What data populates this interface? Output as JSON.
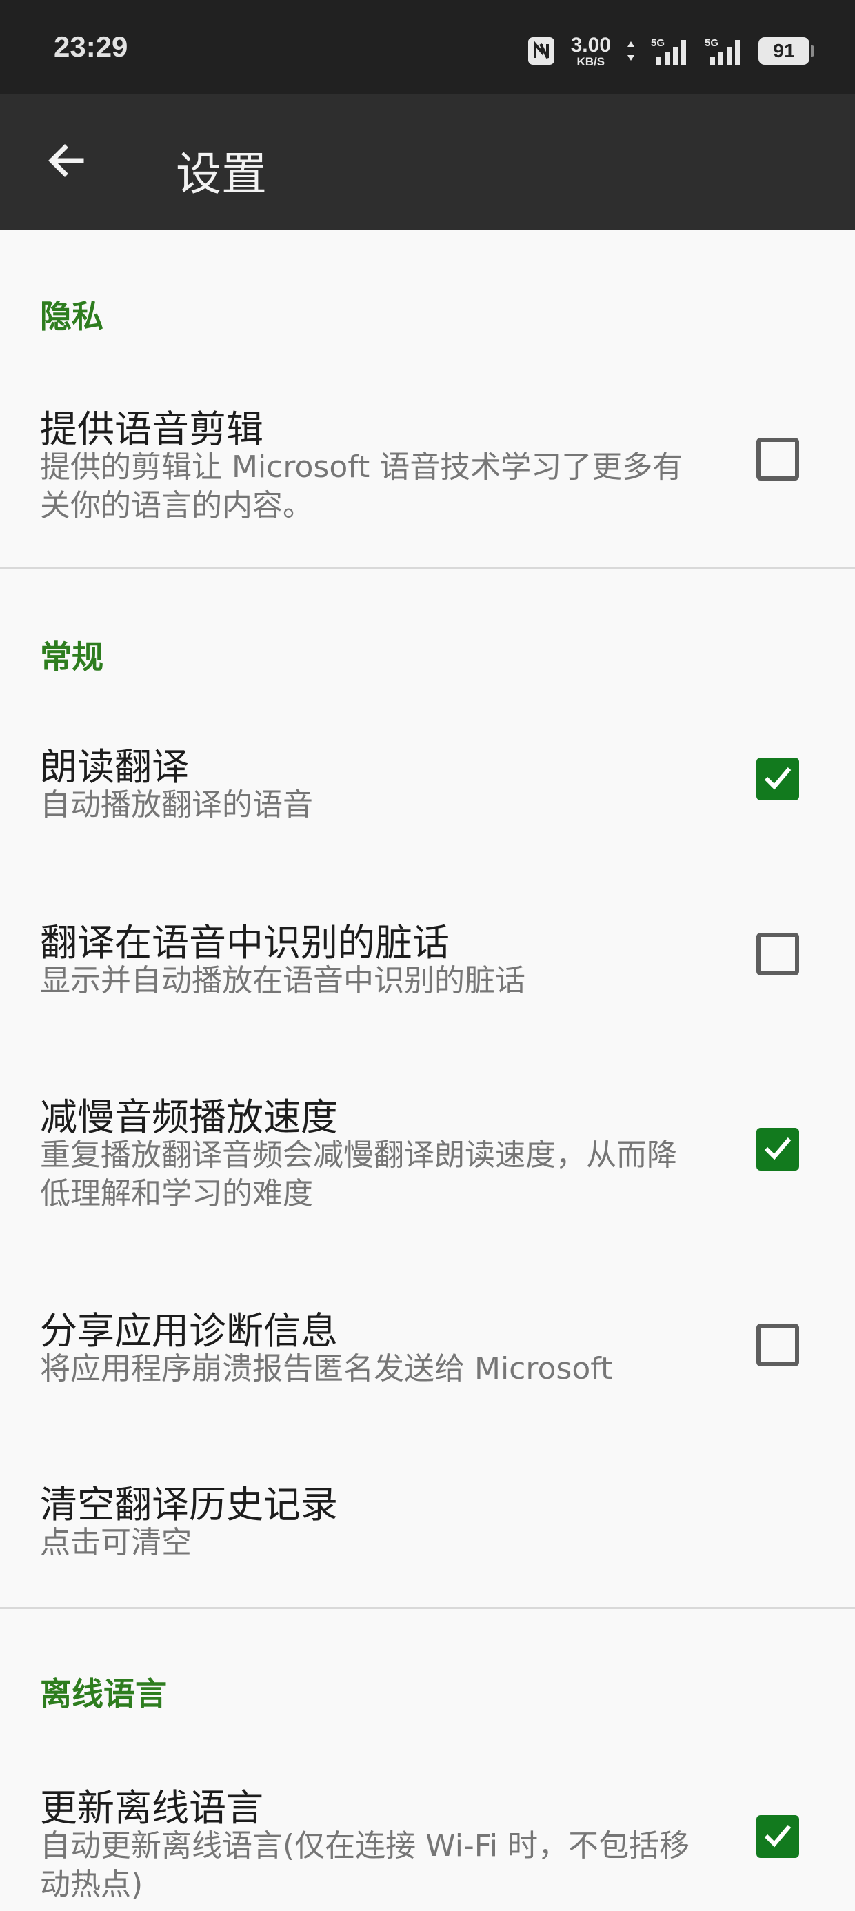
{
  "status_bar": {
    "time": "23:29",
    "net_speed_value": "3.00",
    "net_speed_unit": "KB/S",
    "network_badge_1": "5G",
    "network_badge_2": "5G",
    "battery_level": "91",
    "icons": [
      "nfc-icon",
      "data-arrows-icon",
      "signal-icon",
      "signal-icon",
      "battery-icon"
    ]
  },
  "app_bar": {
    "back_icon": "arrow-left-icon",
    "title": "设置"
  },
  "colors": {
    "accent_green": "#2e7d1f",
    "checkbox_checked": "#127a1e",
    "app_bar_bg": "#2e2e2e",
    "status_bar_bg": "#212121",
    "page_bg": "#f9f9f9"
  },
  "sections": {
    "privacy": {
      "header": "隐私",
      "items": [
        {
          "title": "提供语音剪辑",
          "summary": "提供的剪辑让 Microsoft 语音技术学习了更多有关你的语言的内容。",
          "checked": false
        }
      ]
    },
    "general": {
      "header": "常规",
      "items": [
        {
          "title": "朗读翻译",
          "summary": "自动播放翻译的语音",
          "checked": true
        },
        {
          "title": "翻译在语音中识别的脏话",
          "summary": "显示并自动播放在语音中识别的脏话",
          "checked": false
        },
        {
          "title": "减慢音频播放速度",
          "summary": "重复播放翻译音频会减慢翻译朗读速度，从而降低理解和学习的难度",
          "checked": true
        },
        {
          "title": "分享应用诊断信息",
          "summary": "将应用程序崩溃报告匿名发送给 Microsoft",
          "checked": false
        },
        {
          "title": "清空翻译历史记录",
          "summary": "点击可清空"
        }
      ]
    },
    "offline": {
      "header": "离线语言",
      "items": [
        {
          "title": "更新离线语言",
          "summary": "自动更新离线语言(仅在连接 Wi-Fi 时，不包括移动热点)",
          "checked": true
        }
      ]
    }
  }
}
